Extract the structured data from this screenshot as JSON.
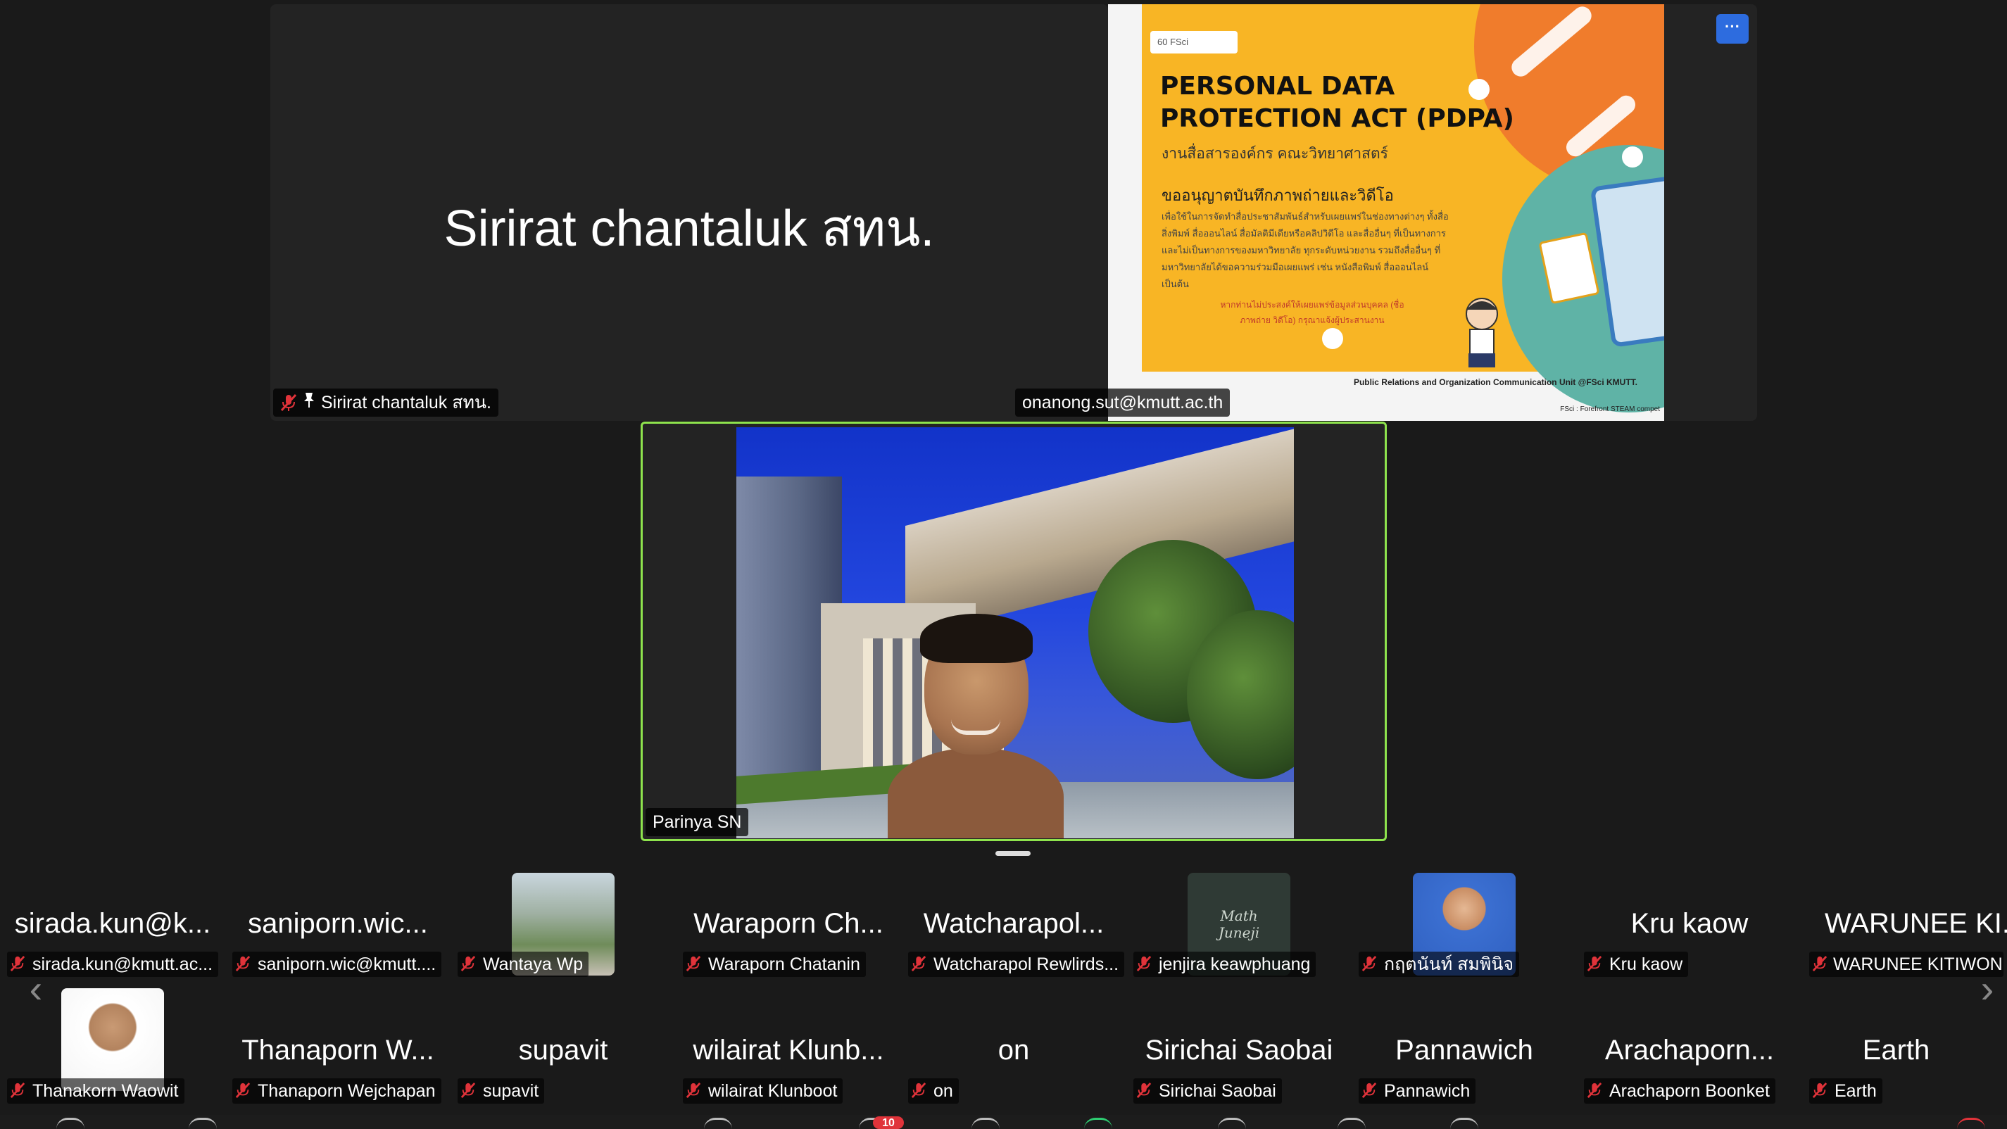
{
  "top_left": {
    "display_name": "Sirirat chantaluk สทน.",
    "label": "Sirirat chantaluk สทน."
  },
  "top_right": {
    "label": "onanong.sut@kmutt.ac.th",
    "more_label": "···",
    "slide": {
      "badge": "60 FSci",
      "title": "PERSONAL DATA PROTECTION ACT (PDPA)",
      "subtitle": "งานสื่อสารองค์กร คณะวิทยาศาสตร์",
      "heading": "ขออนุญาตบันทึกภาพถ่ายและวิดีโอ",
      "body": "เพื่อใช้ในการจัดทำสื่อประชาสัมพันธ์สำหรับเผยแพร่ในช่องทางต่างๆ ทั้งสื่อสิ่งพิมพ์ สื่อออนไลน์ สื่อมัลติมีเดียหรือคลิปวิดีโอ และสื่ออื่นๆ ที่เป็นทางการและไม่เป็นทางการของมหาวิทยาลัย ทุกระดับหน่วยงาน รวมถึงสื่ออื่นๆ ที่มหาวิทยาลัยได้ขอความร่วมมือเผยแพร่ เช่น หนังสือพิมพ์ สื่อออนไลน์ เป็นต้น",
      "note": "หากท่านไม่ประสงค์ให้เผยแพร่ข้อมูลส่วนบุคคล (ชื่อ ภาพถ่าย วิดีโอ) กรุณาแจ้งผู้ประสานงาน",
      "footer": "Public Relations and Organization Communication Unit @FSci KMUTT.",
      "footer2": "FSci : Forefront STEAM compet"
    }
  },
  "active_speaker": {
    "label": "Parinya SN"
  },
  "gallery": {
    "row1": [
      {
        "name": "sirada.kun@k...",
        "label": "sirada.kun@kmutt.ac..."
      },
      {
        "name": "saniporn.wic...",
        "label": "saniporn.wic@kmutt...."
      },
      {
        "name": "",
        "label": "Wantaya Wp"
      },
      {
        "name": "Waraporn Ch...",
        "label": "Waraporn Chatanin"
      },
      {
        "name": "Watcharapol...",
        "label": "Watcharapol Rewlirds..."
      },
      {
        "name": "",
        "label": "jenjira keawphuang",
        "thumb_text": "Math Juneji"
      },
      {
        "name": "",
        "label": "กฤตนันท์ สมพินิจ"
      },
      {
        "name": "Kru kaow",
        "label": "Kru kaow"
      },
      {
        "name": "WARUNEE KI...",
        "label": "WARUNEE KITIWON..."
      }
    ],
    "row2": [
      {
        "name": "",
        "label": "Thanakorn Waowit"
      },
      {
        "name": "Thanaporn W...",
        "label": "Thanaporn Wejchapan"
      },
      {
        "name": "supavit",
        "label": "supavit"
      },
      {
        "name": "wilairat Klunb...",
        "label": "wilairat Klunboot"
      },
      {
        "name": "on",
        "label": "on"
      },
      {
        "name": "Sirichai Saobai",
        "label": "Sirichai Saobai"
      },
      {
        "name": "Pannawich",
        "label": "Pannawich"
      },
      {
        "name": "Arachaporn...",
        "label": "Arachaporn Boonket"
      },
      {
        "name": "Earth",
        "label": "Earth"
      }
    ]
  },
  "toolbar": {
    "chat_badge": "10"
  },
  "colors": {
    "background": "#1a1a1a",
    "tile": "#232323",
    "active_border": "#8ee34d",
    "muted_mic": "#e0333a",
    "more_button": "#2d6cdf"
  },
  "icons": {
    "muted": "mic-muted-icon",
    "pin": "pin-icon",
    "prev": "chevron-left-icon",
    "next": "chevron-right-icon"
  }
}
